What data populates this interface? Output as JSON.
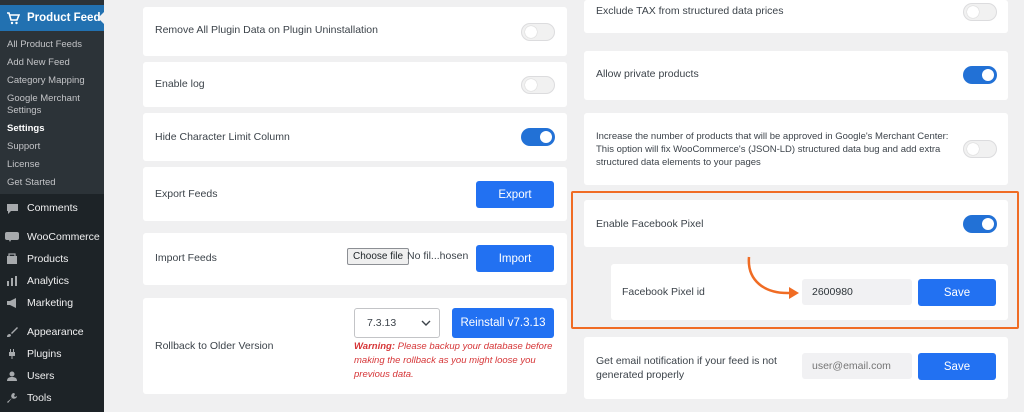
{
  "sidebar": {
    "active": {
      "label": "Product Feed",
      "icon": "cart-icon"
    },
    "submenu": [
      {
        "label": "All Product Feeds",
        "current": false
      },
      {
        "label": "Add New Feed",
        "current": false
      },
      {
        "label": "Category Mapping",
        "current": false
      },
      {
        "label": "Google Merchant Settings",
        "current": false
      },
      {
        "label": "Settings",
        "current": true
      },
      {
        "label": "Support",
        "current": false
      },
      {
        "label": "License",
        "current": false
      },
      {
        "label": "Get Started",
        "current": false
      }
    ],
    "menu": [
      {
        "label": "Comments",
        "icon": "comment-icon"
      },
      {
        "label": "WooCommerce",
        "icon": "woo-icon"
      },
      {
        "label": "Products",
        "icon": "products-icon"
      },
      {
        "label": "Analytics",
        "icon": "analytics-icon"
      },
      {
        "label": "Marketing",
        "icon": "megaphone-icon"
      },
      {
        "label": "Appearance",
        "icon": "brush-icon"
      },
      {
        "label": "Plugins",
        "icon": "plug-icon"
      },
      {
        "label": "Users",
        "icon": "user-icon"
      },
      {
        "label": "Tools",
        "icon": "wrench-icon"
      }
    ]
  },
  "left": {
    "remove_data": {
      "label": "Remove All Plugin Data on Plugin Uninstallation",
      "enabled": false
    },
    "enable_log": {
      "label": "Enable log",
      "enabled": false
    },
    "hide_char": {
      "label": "Hide Character Limit Column",
      "enabled": true
    },
    "export": {
      "label": "Export Feeds",
      "button": "Export"
    },
    "import": {
      "label": "Import Feeds",
      "choose_file": "Choose file",
      "file_status": "No fil...hosen",
      "button": "Import"
    },
    "rollback": {
      "label": "Rollback to Older Version",
      "selected_version": "7.3.13",
      "button": "Reinstall v7.3.13",
      "warning_bold": "Warning:",
      "warning_text": " Please backup your database before making the rollback as you might loose you previous data."
    }
  },
  "right": {
    "exclude_tax": {
      "label": "Exclude TAX from structured data prices",
      "enabled": false
    },
    "private_products": {
      "label": "Allow private products",
      "enabled": true
    },
    "increase_products": {
      "label": "Increase the number of products that will be approved in Google's Merchant Center: This option will fix WooCommerce's (JSON-LD) structured data bug and add extra structured data elements to your pages",
      "enabled": false
    },
    "facebook_pixel": {
      "label": "Enable Facebook Pixel",
      "enabled": true
    },
    "pixel_id": {
      "label": "Facebook Pixel id",
      "value": "2600980",
      "button": "Save"
    },
    "email_notify": {
      "label": "Get email notification if your feed is not generated properly",
      "placeholder": "user@email.com",
      "button": "Save"
    }
  },
  "colors": {
    "accent": "#2271f2",
    "highlight": "#f06c24",
    "sidebar_bg": "#1d2327",
    "active_menu": "#2271b1"
  }
}
